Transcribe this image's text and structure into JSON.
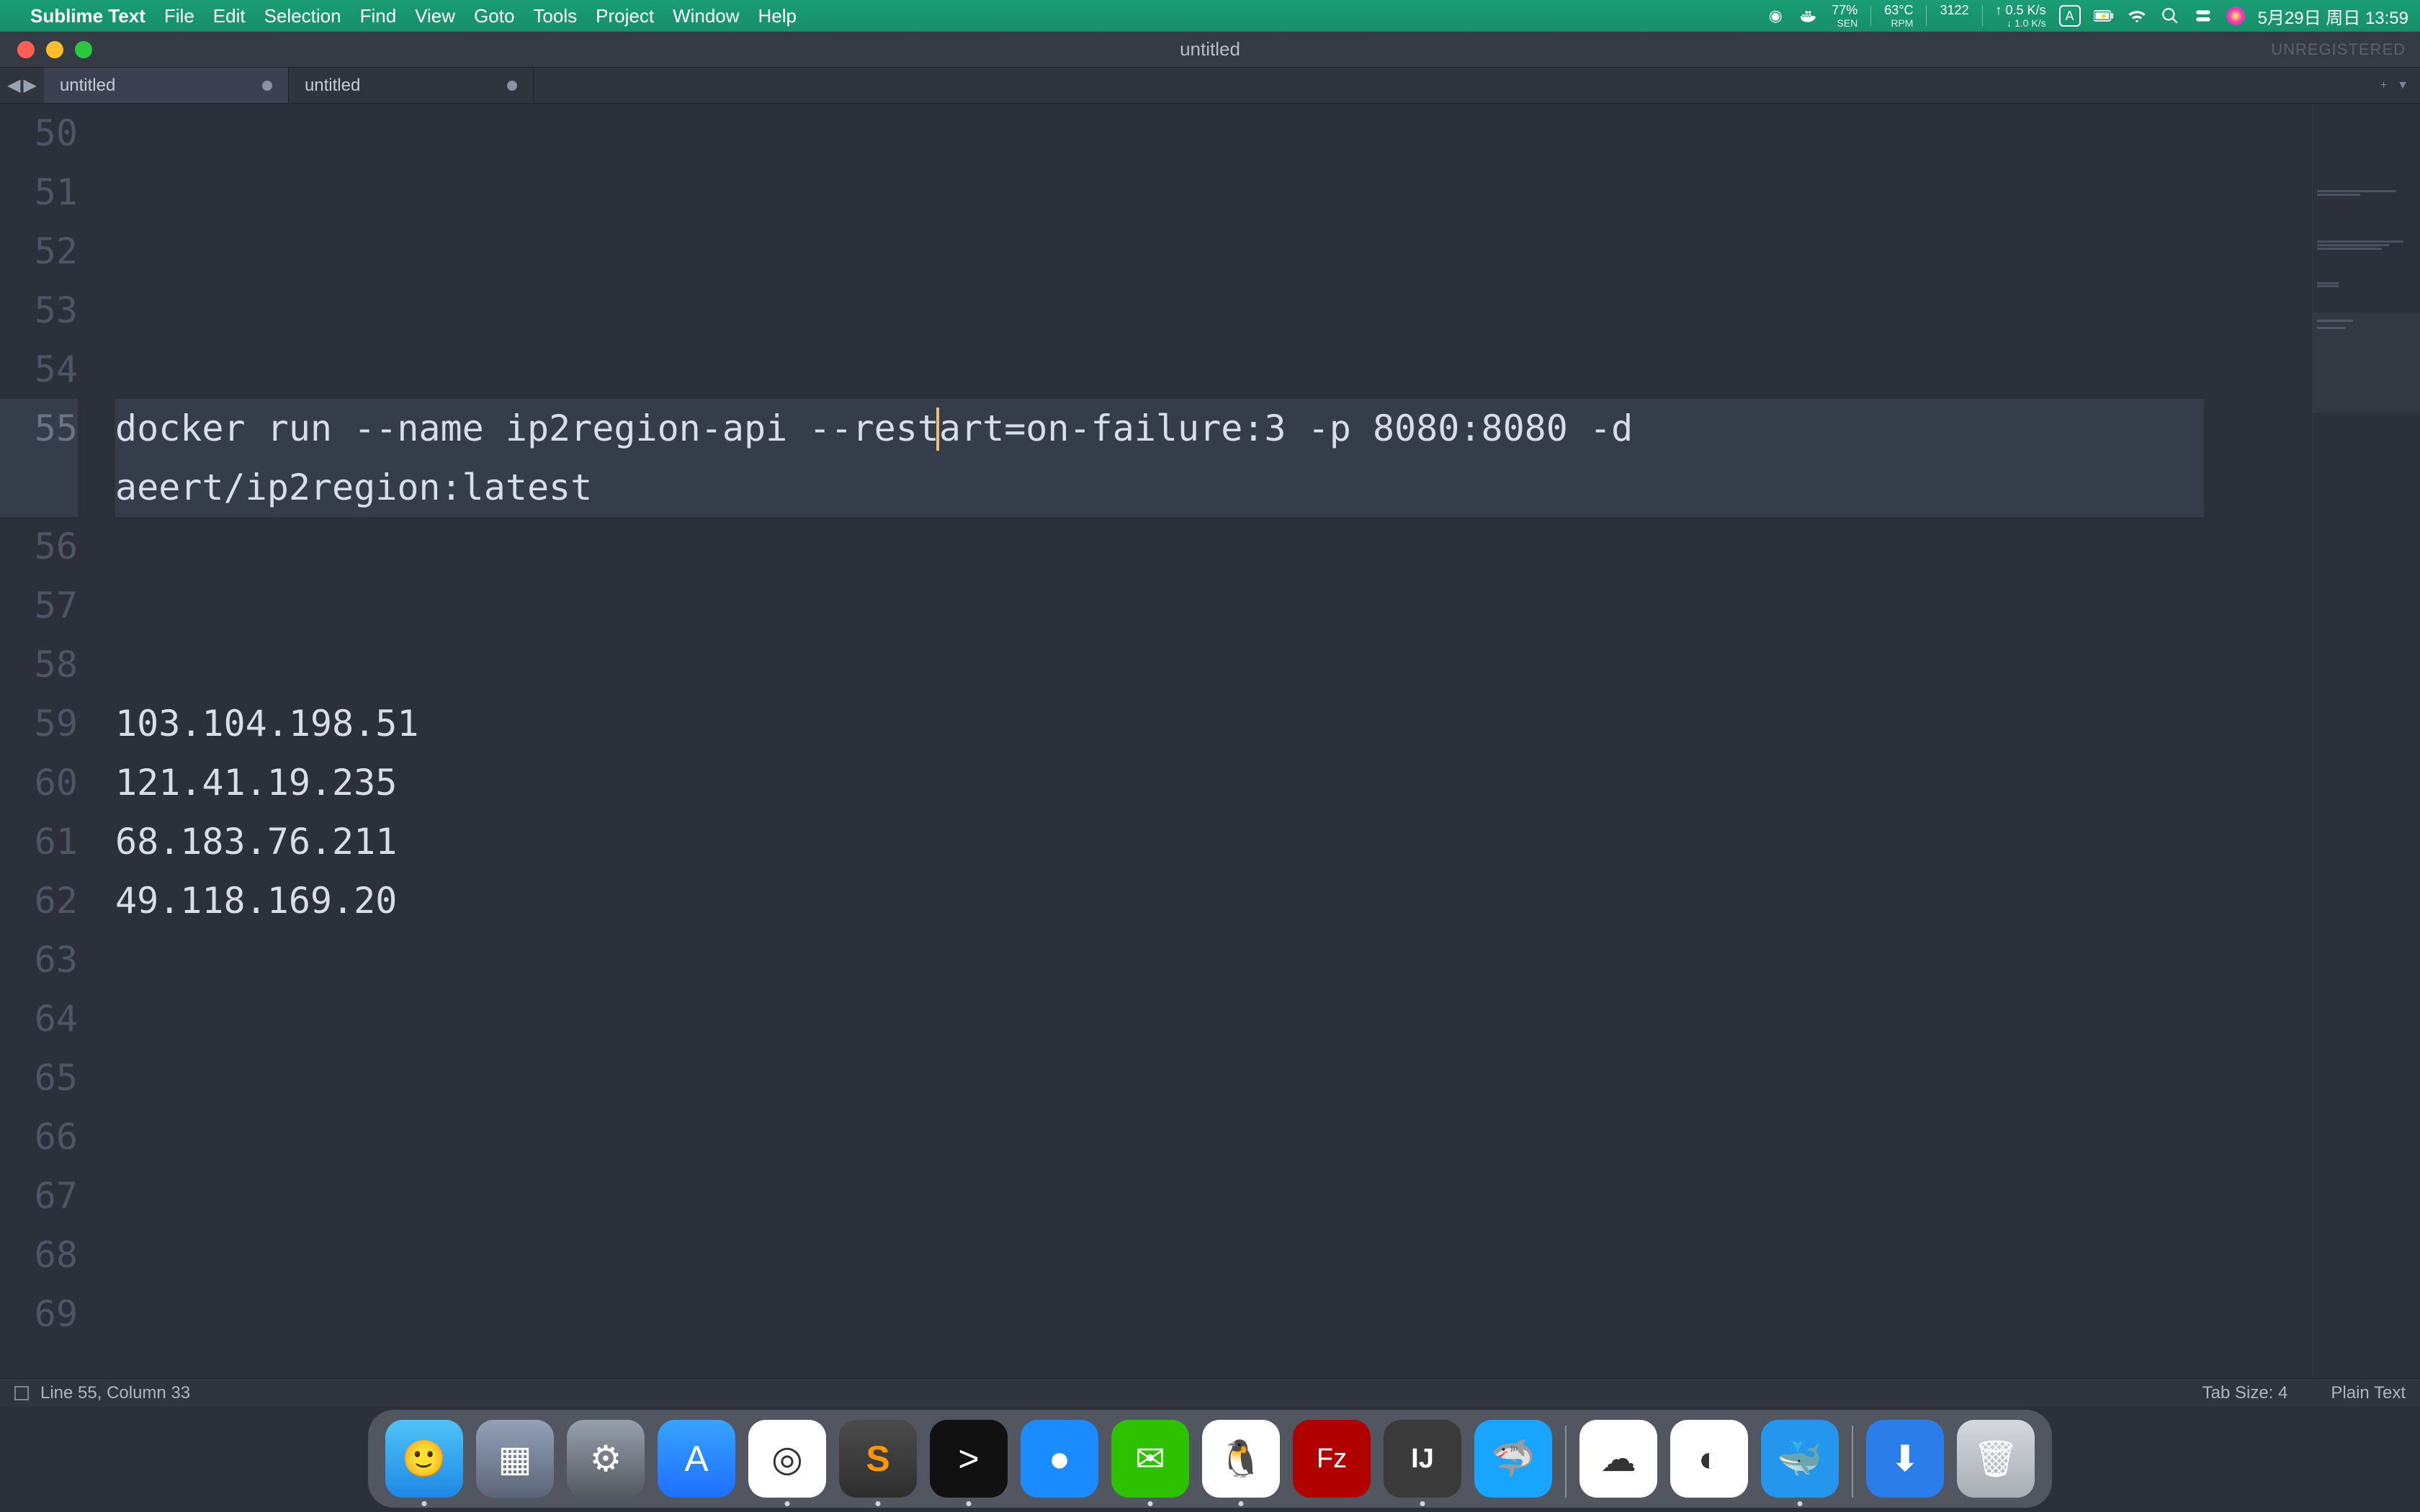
{
  "menubar": {
    "app_name": "Sublime Text",
    "items": [
      "File",
      "Edit",
      "Selection",
      "Find",
      "View",
      "Goto",
      "Tools",
      "Project",
      "Window",
      "Help"
    ],
    "stats": {
      "cpu_pct": "77%",
      "cpu_sub": "SEN",
      "temp": "63°C",
      "temp_sub": "RPM",
      "fan": "3122",
      "net_up": "↑ 0.5 K/s",
      "net_down": "↓ 1.0 K/s"
    },
    "clock": "5月29日 周日 13:59"
  },
  "window": {
    "title": "untitled",
    "unregistered": "UNREGISTERED"
  },
  "tabs": [
    {
      "label": "untitled",
      "active": true,
      "dirty": true
    },
    {
      "label": "untitled",
      "active": false,
      "dirty": true
    }
  ],
  "editor": {
    "first_line_no": 50,
    "lines": [
      {
        "no": 50,
        "text": ""
      },
      {
        "no": 51,
        "text": ""
      },
      {
        "no": 52,
        "text": ""
      },
      {
        "no": 53,
        "text": ""
      },
      {
        "no": 54,
        "text": ""
      },
      {
        "no": 55,
        "text": "docker run --name ip2region-api --restart=on-failure:3 -p 8080:8080 -d aeert/ip2region:latest",
        "active": true
      },
      {
        "no": 56,
        "text": ""
      },
      {
        "no": 57,
        "text": ""
      },
      {
        "no": 58,
        "text": ""
      },
      {
        "no": 59,
        "text": "103.104.198.51"
      },
      {
        "no": 60,
        "text": "121.41.19.235"
      },
      {
        "no": 61,
        "text": "68.183.76.211"
      },
      {
        "no": 62,
        "text": "49.118.169.20"
      },
      {
        "no": 63,
        "text": ""
      },
      {
        "no": 64,
        "text": ""
      },
      {
        "no": 65,
        "text": ""
      },
      {
        "no": 66,
        "text": ""
      },
      {
        "no": 67,
        "text": ""
      },
      {
        "no": 68,
        "text": ""
      },
      {
        "no": 69,
        "text": ""
      }
    ],
    "caret": {
      "line": 55,
      "column": 33
    }
  },
  "statusbar": {
    "position": "Line 55, Column 33",
    "tab_size": "Tab Size: 4",
    "syntax": "Plain Text"
  },
  "dock": {
    "apps": [
      {
        "name": "finder",
        "running": true,
        "glyph": "🙂"
      },
      {
        "name": "launchpad",
        "running": false,
        "glyph": "▦"
      },
      {
        "name": "system-preferences",
        "running": false,
        "glyph": "⚙"
      },
      {
        "name": "app-store",
        "running": false,
        "glyph": "A"
      },
      {
        "name": "chrome",
        "running": true,
        "glyph": "◎"
      },
      {
        "name": "sublime-text",
        "running": true,
        "glyph": "S"
      },
      {
        "name": "terminal",
        "running": true,
        "glyph": ">"
      },
      {
        "name": "1password",
        "running": false,
        "glyph": "●"
      },
      {
        "name": "wechat",
        "running": true,
        "glyph": "✉"
      },
      {
        "name": "qq",
        "running": true,
        "glyph": "🐧"
      },
      {
        "name": "filezilla",
        "running": false,
        "glyph": "Fz"
      },
      {
        "name": "intellij",
        "running": true,
        "glyph": "IJ"
      },
      {
        "name": "wireshark",
        "running": false,
        "glyph": "🦈"
      }
    ],
    "apps_right": [
      {
        "name": "cloud-app",
        "running": false,
        "glyph": "☁"
      },
      {
        "name": "tencent-meeting",
        "running": false,
        "glyph": "◐"
      },
      {
        "name": "docker",
        "running": true,
        "glyph": "🐳"
      }
    ],
    "pinned": [
      {
        "name": "downloads",
        "glyph": "⬇"
      },
      {
        "name": "trash",
        "glyph": "🗑"
      }
    ]
  }
}
